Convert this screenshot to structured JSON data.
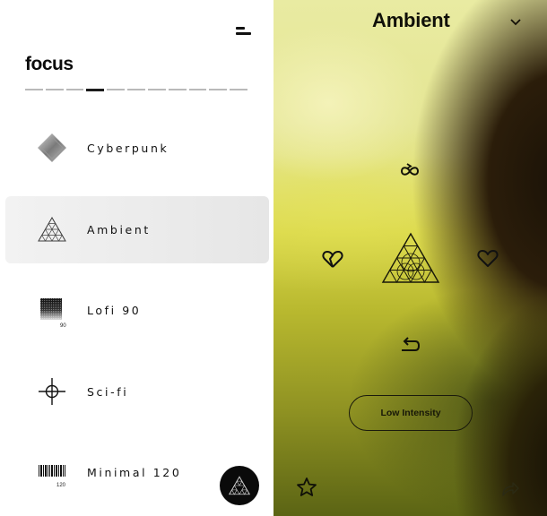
{
  "app": {
    "brand": "focus"
  },
  "pager": {
    "segments": 11,
    "active_index": 3
  },
  "moods": [
    {
      "name": "Cyberpunk",
      "icon": "diamond-icon",
      "badge": ""
    },
    {
      "name": "Ambient",
      "icon": "triangle-mesh-icon",
      "badge": ""
    },
    {
      "name": "Lofi 90",
      "icon": "noise-square-icon",
      "badge": "90"
    },
    {
      "name": "Sci-fi",
      "icon": "crosshair-icon",
      "badge": ""
    },
    {
      "name": "Minimal 120",
      "icon": "barcode-icon",
      "badge": "120"
    }
  ],
  "selected_mood": "Ambient",
  "player": {
    "title": "Ambient",
    "intensity_label": "Low Intensity"
  },
  "colors": {
    "drawer_bg": "#ffffff",
    "selected_row": "#ececec",
    "fab_bg": "#0a0a0a",
    "player_light": "#e9eba2",
    "player_dark": "#1a1207"
  }
}
